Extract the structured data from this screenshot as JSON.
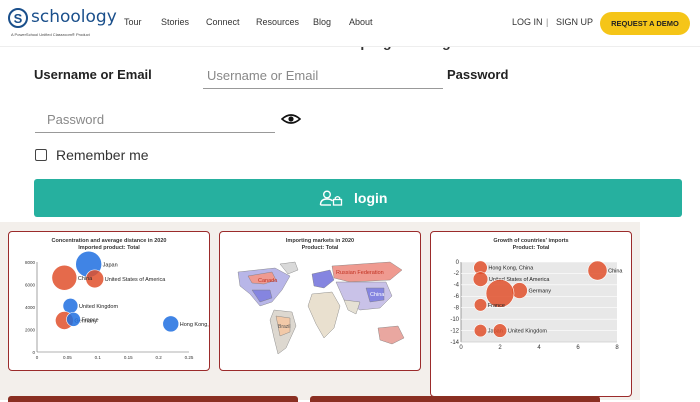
{
  "header": {
    "logo_mark": "S",
    "logo_text": "schoology",
    "logo_tagline": "A PowerSchool Unified Classroom® Product",
    "nav": [
      "Tour",
      "Stories",
      "Connect",
      "Resources",
      "Blog",
      "About"
    ],
    "login_link": "LOG IN",
    "separator": "|",
    "signup_link": "SIGN UP",
    "demo_button": "REQUEST A DEMO"
  },
  "form": {
    "welcome": "Welcome to the world of programming",
    "username_label": "Username or Email",
    "username_placeholder": "Username or Email",
    "password_label": "Password",
    "password_placeholder": "Password",
    "remember_label": "Remember me",
    "login_button": "login",
    "eye_icon": "eye-icon",
    "login_icon": "user-lock-icon"
  },
  "colors": {
    "accent": "#26b09f",
    "demo": "#f5c518",
    "logo": "#1a4f8b",
    "bubble_blue": "#1f6fe0",
    "bubble_red": "#e0502c",
    "panel_border": "#9b2b2b"
  },
  "chart_data": [
    {
      "type": "scatter",
      "title": "Concentration and average distance in 2020",
      "subtitle": "Imported product: Total",
      "xlim": [
        0,
        0.25
      ],
      "ylim": [
        0,
        8000
      ],
      "x_ticks": [
        "0",
        "0.05",
        "0.1",
        "0.15",
        "0.2",
        "0.25"
      ],
      "y_ticks": [
        "0",
        "2000",
        "4000",
        "6000",
        "8000"
      ],
      "series": [
        {
          "x": 0.085,
          "y": 7800,
          "size": 1.0,
          "color": "blue",
          "label": "Japan"
        },
        {
          "x": 0.095,
          "y": 6500,
          "size": 0.6,
          "color": "red",
          "label": "United States of America"
        },
        {
          "x": 0.045,
          "y": 6600,
          "size": 0.95,
          "color": "red",
          "label": "China"
        },
        {
          "x": 0.055,
          "y": 4100,
          "size": 0.45,
          "color": "blue",
          "label": "United Kingdom"
        },
        {
          "x": 0.045,
          "y": 2800,
          "size": 0.6,
          "color": "red",
          "label": "Germany"
        },
        {
          "x": 0.06,
          "y": 2900,
          "size": 0.4,
          "color": "blue",
          "label": "France"
        },
        {
          "x": 0.22,
          "y": 2500,
          "size": 0.5,
          "color": "blue",
          "label": "Hong Kong, China"
        }
      ]
    },
    {
      "type": "map",
      "title": "Importing markets in 2020",
      "subtitle": "Product: Total",
      "labels": [
        "Canada",
        "Russian Federation",
        "China",
        "Brazil"
      ]
    },
    {
      "type": "scatter",
      "title": "Growth of countries' imports",
      "subtitle": "Product: Total",
      "xlim": [
        0,
        8
      ],
      "ylim": [
        -14,
        0
      ],
      "x_ticks": [
        "0",
        "2",
        "4",
        "6",
        "8"
      ],
      "y_ticks": [
        "0",
        "-2",
        "-4",
        "-6",
        "-8",
        "-10",
        "-12",
        "-14"
      ],
      "series": [
        {
          "x": 1.0,
          "y": -1.0,
          "size": 0.35,
          "color": "red",
          "label": "Hong Kong, China"
        },
        {
          "x": 7.0,
          "y": -1.5,
          "size": 0.6,
          "color": "red",
          "label": "China"
        },
        {
          "x": 1.0,
          "y": -3.0,
          "size": 0.4,
          "color": "red",
          "label": "United States of America"
        },
        {
          "x": 3.0,
          "y": -5.0,
          "size": 0.45,
          "color": "red",
          "label": "Germany"
        },
        {
          "x": 2.0,
          "y": -5.5,
          "size": 1.0,
          "color": "red",
          "label": ""
        },
        {
          "x": 1.0,
          "y": -7.5,
          "size": 0.3,
          "color": "red",
          "label": "France"
        },
        {
          "x": 1.0,
          "y": -12.0,
          "size": 0.3,
          "color": "red",
          "label": "Japan"
        },
        {
          "x": 2.0,
          "y": -12.0,
          "size": 0.35,
          "color": "red",
          "label": "United Kingdom"
        }
      ]
    }
  ]
}
